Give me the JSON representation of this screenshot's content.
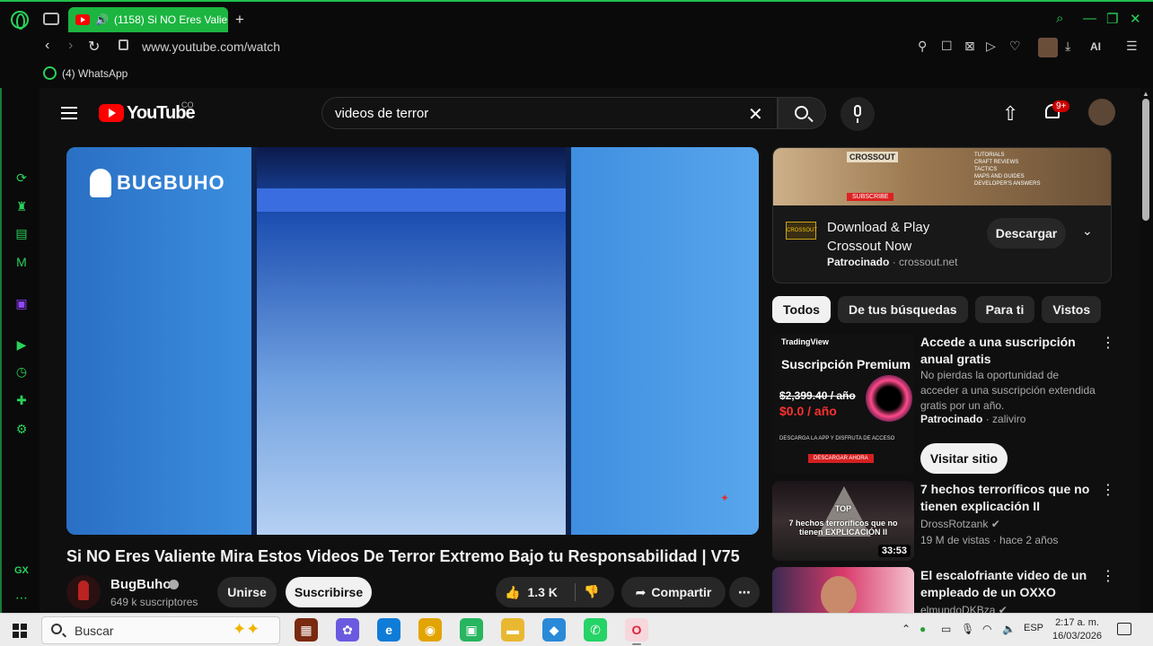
{
  "browser": {
    "tab_title": "(1158) Si NO Eres Valie",
    "url": "www.youtube.com/watch",
    "bookmark_whatsapp": "(4) WhatsApp",
    "tool_ai": "AI",
    "sidebar_gx": "GX",
    "accent": "#1fc04a"
  },
  "youtube": {
    "logo_text": "YouTube",
    "region": "CO",
    "search_query": "videos de terror",
    "notification_count": "9+",
    "video": {
      "watermark": "BUGBUHO",
      "title": "Si NO Eres Valiente Mira Estos Videos De Terror Extremo Bajo tu Responsabilidad | V75",
      "channel": "BugBuho",
      "subscribers": "649 k suscriptores",
      "join_label": "Unirse",
      "subscribe_label": "Suscribirse",
      "likes": "1.3 K",
      "share_label": "Compartir"
    },
    "ad": {
      "banner_logo": "CROSSOUT",
      "banner_list": [
        "TUTORIALS",
        "CRAFT REVIEWS",
        "TACTICS",
        "MAPS AND GUIDES",
        "DEVELOPER'S ANSWERS"
      ],
      "banner_button": "SUBSCRIBE",
      "title": "Download & Play Crossout Now",
      "sponsored": "Patrocinado",
      "domain": "crossout.net",
      "download_label": "Descargar"
    },
    "chips": [
      "Todos",
      "De tus búsquedas",
      "Para ti",
      "Vistos"
    ],
    "recommendations": [
      {
        "title": "Accede a una suscripción anual gratis",
        "description": "No pierdas la oportunidad de acceder a una suscripción extendida gratis por un año.",
        "sponsored": "Patrocinado",
        "advertiser": "zaliviro",
        "cta": "Visitar sitio",
        "thumb_brand": "TradingView",
        "thumb_headline": "Suscripción Premium",
        "thumb_old_price": "$2,399.40 / año",
        "thumb_new_price": "$0.0 / año",
        "thumb_fine": "DESCARGA LA APP Y DISFRUTA DE ACCESO",
        "thumb_cta": "DESCARGAR AHORA"
      },
      {
        "title": "7 hechos terroríficos que no tienen explicación II",
        "channel": "DrossRotzank",
        "meta": "19 M de vistas · hace 2 años",
        "duration": "33:53",
        "thumb_text": "7 hechos terroríficos que no tienen EXPLICACIÓN II",
        "thumb_top": "TOP"
      },
      {
        "title": "El escalofriante video de un empleado de un OXXO",
        "channel": "elmundoDKBza"
      }
    ]
  },
  "taskbar": {
    "search_placeholder": "Buscar",
    "language": "ESP",
    "time": "2:17 a. m.",
    "date": "16/03/2026"
  }
}
